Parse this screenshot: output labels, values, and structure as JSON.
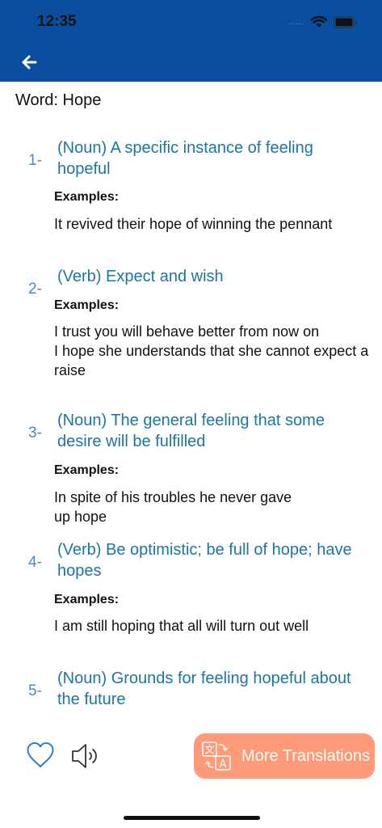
{
  "status_bar": {
    "time": "12:35",
    "signal": "....."
  },
  "word": {
    "label": "Word: Hope"
  },
  "examples_label": "Examples:",
  "entries": [
    {
      "number": "1-",
      "definition": "(Noun)  A specific instance of feeling hopeful",
      "examples": "It revived their hope of winning the pennant"
    },
    {
      "number": "2-",
      "definition": "(Verb)  Expect and wish",
      "examples": "I trust you will behave better from now on\nI hope she understands that she cannot expect a raise"
    },
    {
      "number": "3-",
      "definition": "(Noun)  The general feeling that some desire will be fulfilled",
      "examples": "In spite of his troubles he never gave\nup hope"
    },
    {
      "number": "4-",
      "definition": "(Verb)  Be optimistic; be full of hope; have hopes",
      "examples": "I am still hoping that all will turn out well"
    },
    {
      "number": "5-",
      "definition": "(Noun)  Grounds for feeling hopeful about the future"
    }
  ],
  "bottom_bar": {
    "more_translations": "More Translations"
  },
  "icons": {
    "back": "back-arrow-icon",
    "favorite": "heart-icon",
    "speaker": "speaker-icon",
    "translate": "translate-icon"
  },
  "colors": {
    "header": "#0a4f9f",
    "definition": "#1b76a3",
    "entry_number": "#4f82d6",
    "more_button": "#ff9a78",
    "icon_blue": "#2f7fc8"
  }
}
